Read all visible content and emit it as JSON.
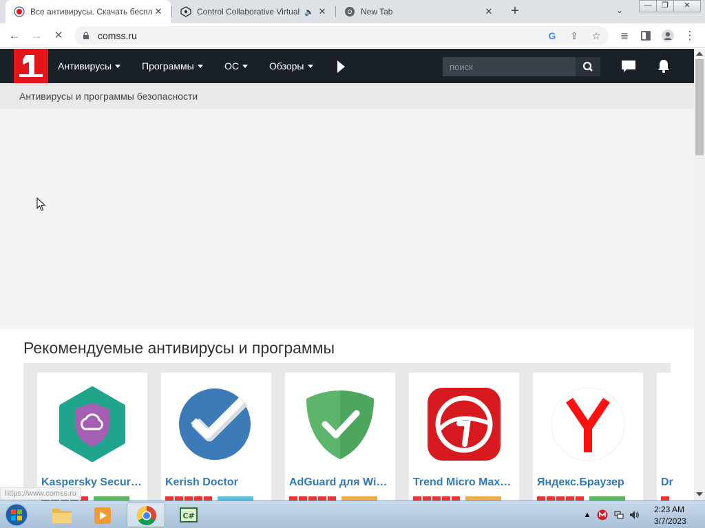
{
  "browser": {
    "tabs": [
      {
        "title": "Все антивирусы. Скачать беспл",
        "active": true
      },
      {
        "title": "Control Collaborative Virtual",
        "active": false,
        "audio": true
      },
      {
        "title": "New Tab",
        "active": false
      }
    ],
    "newtab_label": "+",
    "tab_close": "✕",
    "tab_menu": "⌄",
    "window_controls": {
      "minimize": "—",
      "restore": "❐",
      "close": "✕"
    },
    "nav": {
      "back": "←",
      "forward": "→",
      "stop": "✕"
    },
    "url": "comss.ru",
    "status_url": "https://www.comss.ru"
  },
  "site": {
    "logo_text": "1",
    "menu": [
      {
        "label": "Антивирусы"
      },
      {
        "label": "Программы"
      },
      {
        "label": "ОС"
      },
      {
        "label": "Обзоры"
      }
    ],
    "search": {
      "placeholder": "поиск"
    },
    "breadcrumb": "Антивирусы и программы безопасности",
    "recommended": {
      "title": "Рекомендуемые антивирусы и программы",
      "cards": [
        {
          "name": "Kaspersky Secur…",
          "icon": "kaspersky-icon",
          "badge_color": "#5cb85c"
        },
        {
          "name": "Kerish Doctor",
          "icon": "kerish-doctor-icon",
          "badge_color": "#5bc0de"
        },
        {
          "name": "AdGuard для Wi…",
          "icon": "adguard-icon",
          "badge_color": "#f0ad4e"
        },
        {
          "name": "Trend Micro Max…",
          "icon": "trend-micro-icon",
          "badge_color": "#f0ad4e"
        },
        {
          "name": "Яндекс.Браузер",
          "icon": "yandex-browser-icon",
          "badge_color": "#5cb85c"
        },
        {
          "name": "Dr",
          "icon": "drweb-icon",
          "badge_color": "#5cb85c"
        }
      ]
    }
  },
  "taskbar": {
    "apps": [
      "explorer",
      "media-player",
      "chrome",
      "csharp-ide"
    ],
    "clock_time": "2:23 AM",
    "clock_date": "3/7/2023"
  },
  "colors": {
    "header_bg": "#1a2028",
    "logo_red": "#e4161c",
    "link_blue": "#2f7bbf"
  }
}
